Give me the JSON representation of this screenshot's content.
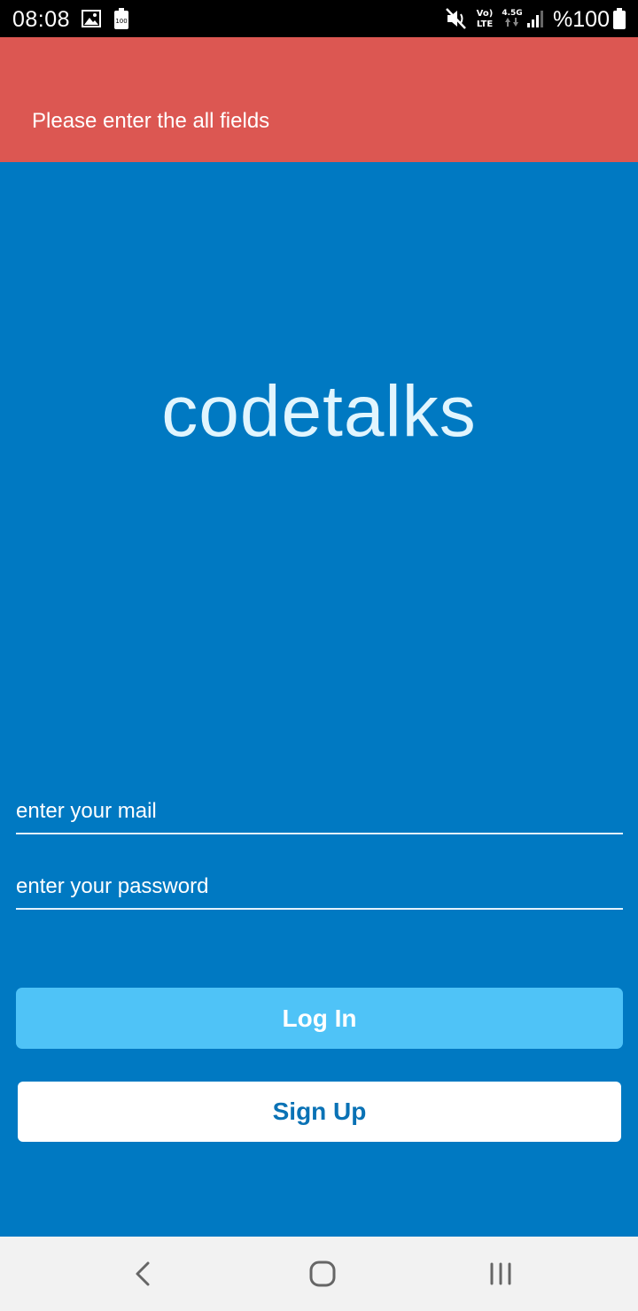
{
  "status_bar": {
    "time": "08:08",
    "battery_percent": "%100",
    "network_label_top": "Vo)",
    "network_label_bottom": "LTE",
    "network_speed": "4.5G",
    "icons": [
      "gallery-icon",
      "battery-100-icon",
      "mute-icon",
      "volte-icon",
      "data-arrows-icon",
      "signal-icon",
      "battery-icon"
    ]
  },
  "error_banner": {
    "message": "Please enter the all fields",
    "color": "#dc5752"
  },
  "app": {
    "title": "codetalks",
    "background_color": "#0079c2"
  },
  "form": {
    "email_placeholder": "enter your mail",
    "email_value": "",
    "password_placeholder": "enter your password",
    "password_value": "",
    "login_label": "Log In",
    "signup_label": "Sign Up",
    "login_color": "#4fc3f7",
    "signup_text_color": "#0a72b5"
  },
  "nav_bar": {
    "icons": [
      "back-icon",
      "home-icon",
      "recents-icon"
    ]
  }
}
